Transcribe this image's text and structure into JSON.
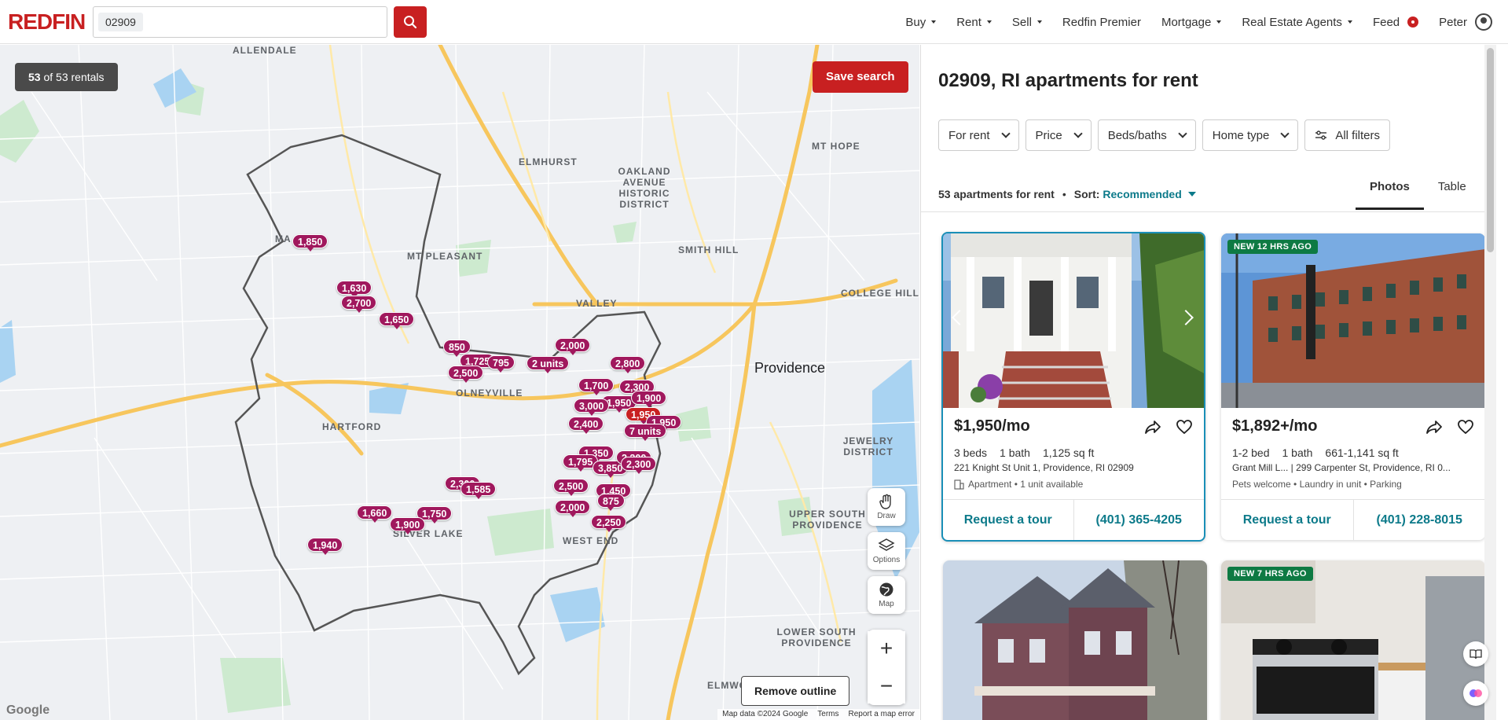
{
  "header": {
    "logo": "REDFIN",
    "search_value": "02909",
    "nav": [
      {
        "label": "Buy",
        "caret": true
      },
      {
        "label": "Rent",
        "caret": true
      },
      {
        "label": "Sell",
        "caret": true
      },
      {
        "label": "Redfin Premier",
        "caret": false
      },
      {
        "label": "Mortgage",
        "caret": true
      },
      {
        "label": "Real Estate Agents",
        "caret": true
      },
      {
        "label": "Feed",
        "caret": false
      },
      {
        "label": "Peter",
        "caret": true
      }
    ]
  },
  "map": {
    "rentals_count": "53",
    "rentals_of": "of 53 rentals",
    "save_search": "Save search",
    "remove_outline": "Remove outline",
    "controls": {
      "draw": "Draw",
      "options": "Options",
      "map": "Map"
    },
    "footer": {
      "data": "Map data ©2024 Google",
      "terms": "Terms",
      "report": "Report a map error"
    },
    "google": "Google",
    "labels": [
      {
        "text": "ALLENDALE"
      },
      {
        "text": "ELMHURST"
      },
      {
        "text": "OAKLAND AVENUE HISTORIC DISTRICT"
      },
      {
        "text": "MT HOPE"
      },
      {
        "text": "MT PLEASANT"
      },
      {
        "text": "SMITH HILL"
      },
      {
        "text": "COLLEGE HILL"
      },
      {
        "text": "VALLEY"
      },
      {
        "text": "OLNEYVILLE"
      },
      {
        "text": "HARTFORD"
      },
      {
        "text": "Providence"
      },
      {
        "text": "JEWELRY DISTRICT"
      },
      {
        "text": "SILVER LAKE"
      },
      {
        "text": "WEST END"
      },
      {
        "text": "UPPER SOUTH PROVIDENCE"
      },
      {
        "text": "LOWER SOUTH PROVIDENCE"
      },
      {
        "text": "ELMWOOD"
      },
      {
        "text": "MA"
      }
    ],
    "pins": [
      "1,850",
      "1,630",
      "2,700",
      "1,650",
      "850",
      "1,725",
      "795",
      "2,500",
      "2,000",
      "2 units",
      "2,800",
      "1,700",
      "2,300",
      "1,950",
      "1,900",
      "3,000",
      "1,950",
      "2,400",
      "1,950",
      "7 units",
      "1,350",
      "1,795",
      "3,850",
      "2,200",
      "2,300",
      "2,300",
      "1,585",
      "2,500",
      "1,450",
      "875",
      "2,000",
      "2,250",
      "1,660",
      "1,750",
      "1,900",
      "1,940"
    ]
  },
  "panel": {
    "title": "02909, RI apartments for rent",
    "filters": [
      "For rent",
      "Price",
      "Beds/baths",
      "Home type"
    ],
    "all_filters": "All filters",
    "results_count": "53 apartments for rent",
    "sort_label": "Sort:",
    "sort_value": "Recommended",
    "tabs": [
      "Photos",
      "Table"
    ],
    "listings": [
      {
        "badge": "",
        "price": "$1,950/mo",
        "beds": "3 beds",
        "baths": "1 bath",
        "sqft": "1,125 sq ft",
        "address": "221 Knight St Unit 1, Providence, RI 02909",
        "meta": "Apartment • 1 unit available",
        "tour": "Request a tour",
        "phone": "(401) 365-4205"
      },
      {
        "badge": "NEW 12 HRS AGO",
        "price": "$1,892+/mo",
        "beds": "1-2 bed",
        "baths": "1 bath",
        "sqft": "661-1,141 sq ft",
        "address": "Grant Mill L... | 299 Carpenter St, Providence, RI 0...",
        "meta": "Pets welcome • Laundry in unit • Parking",
        "tour": "Request a tour",
        "phone": "(401) 228-8015"
      },
      {
        "badge": ""
      },
      {
        "badge": "NEW 7 HRS AGO"
      }
    ]
  },
  "colors": {
    "brand": "#c82021",
    "pin": "#a0185d",
    "link": "#0c7a8a",
    "badge_new": "#0e7a43"
  }
}
